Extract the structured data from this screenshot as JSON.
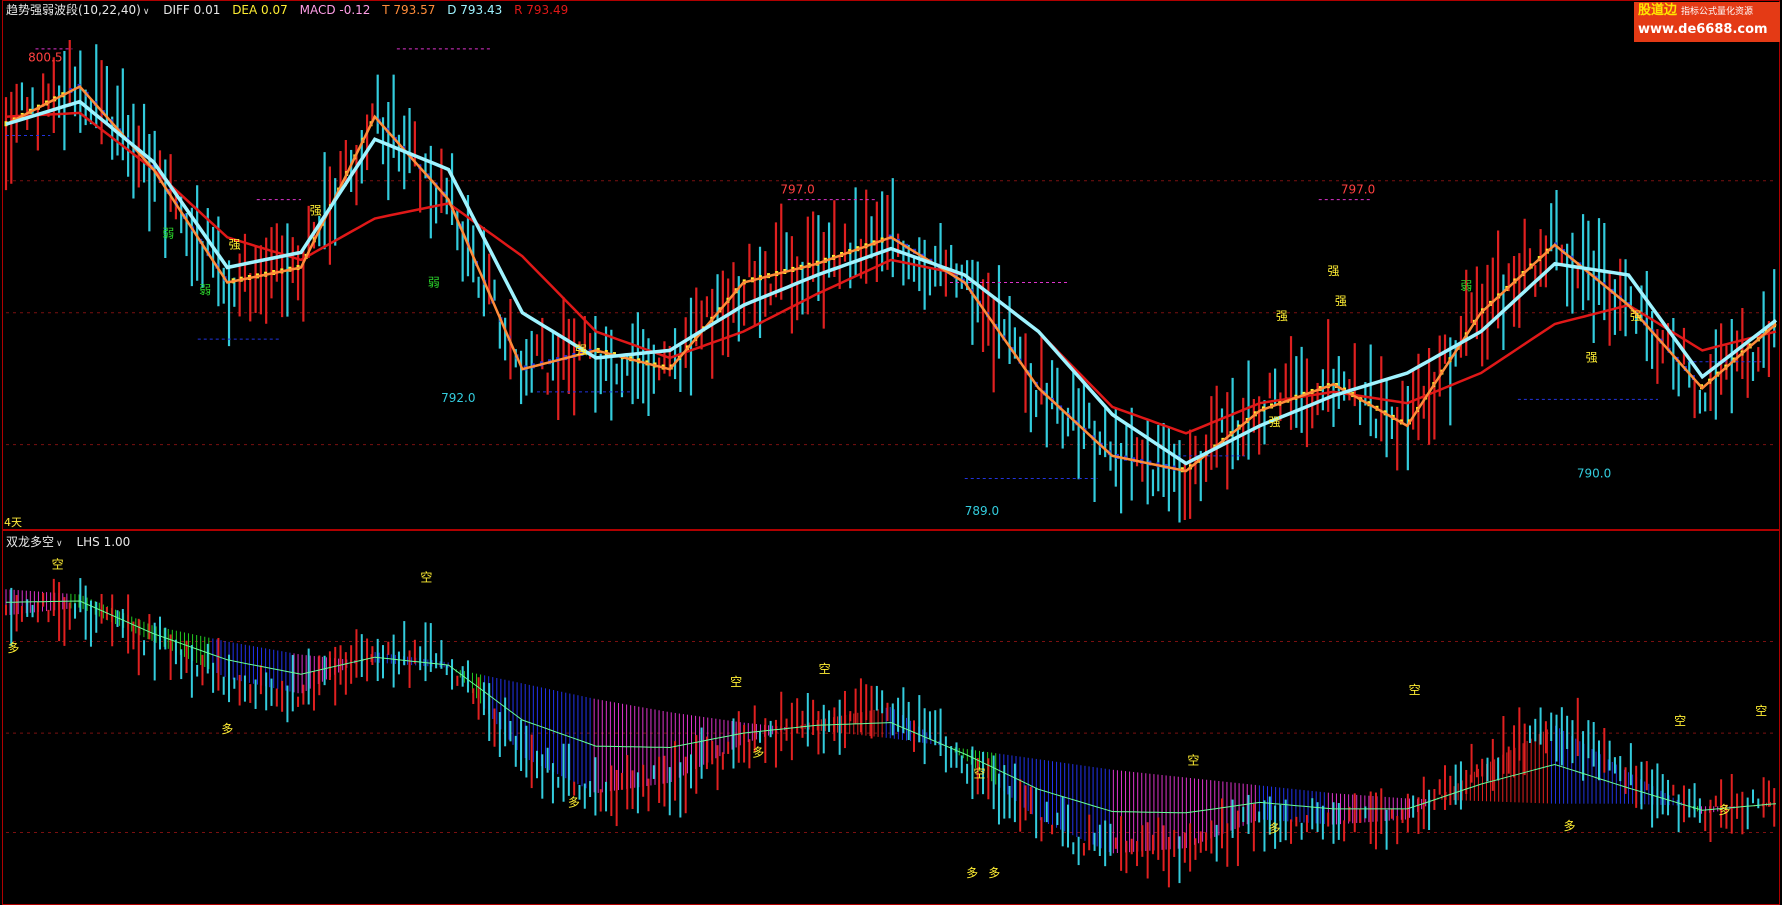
{
  "header_top": {
    "indicator_name": "趋势强弱波段(10,22,40)",
    "diff_label": "DIFF 0.01",
    "dea_label": "DEA 0.07",
    "macd_label": "MACD -0.12",
    "t_label": "T 793.57",
    "d_label": "D 793.43",
    "r_label": "R 793.49"
  },
  "header_bottom": {
    "indicator_name": "双龙多空",
    "lhs_label": "LHS 1.00"
  },
  "days_label": "4天",
  "logo": {
    "line1": "股道边",
    "line1_small": "指标公式量化资源",
    "line2": "www.de6688.com"
  },
  "colors": {
    "background": "#000000",
    "border": "#b00000",
    "up_bar": "#e02020",
    "down_bar": "#33ccdd",
    "white_line": "#9ff3ff",
    "orange_line": "#ff8c3a",
    "red_line": "#e01818",
    "label_yellow": "#ffee33",
    "label_red": "#ff4040",
    "label_cyan": "#33ccdd",
    "dashed_red": "#7a1010",
    "magenta_dash": "#dd33cc",
    "blue_dash": "#2233dd"
  },
  "chart_data": [
    {
      "type": "line",
      "panel": "top",
      "x": [
        0,
        10,
        20,
        30,
        40,
        50,
        60,
        70,
        80,
        90,
        100,
        110,
        120,
        130,
        140,
        150,
        160,
        170,
        180,
        190,
        200,
        210,
        220,
        230,
        240
      ],
      "ylim": [
        788.5,
        801.5
      ],
      "series": [
        {
          "key": "white",
          "values": [
            799.0,
            799.6,
            798.0,
            795.2,
            795.6,
            798.6,
            797.8,
            794.0,
            792.8,
            793.0,
            794.2,
            795.0,
            795.7,
            795.0,
            793.5,
            791.3,
            790.0,
            791.0,
            791.8,
            792.4,
            793.5,
            795.3,
            795.0,
            792.3,
            793.8
          ]
        },
        {
          "key": "orange",
          "values": [
            799.0,
            800.0,
            797.8,
            794.8,
            795.2,
            799.2,
            797.0,
            792.5,
            793.0,
            792.5,
            794.8,
            795.3,
            796.0,
            794.8,
            792.0,
            790.2,
            789.8,
            791.4,
            792.1,
            791.0,
            794.0,
            795.8,
            794.2,
            792.0,
            793.7
          ]
        },
        {
          "key": "red",
          "values": [
            799.2,
            799.3,
            797.8,
            796.0,
            795.4,
            796.5,
            796.9,
            795.5,
            793.5,
            792.8,
            793.5,
            794.5,
            795.4,
            795.0,
            793.5,
            791.5,
            790.8,
            791.6,
            791.9,
            791.6,
            792.4,
            793.7,
            794.2,
            793.0,
            793.5
          ]
        }
      ],
      "annotations": [
        {
          "text": "800.5",
          "x": 3,
          "y": 800.5,
          "color": "label_red"
        },
        {
          "text": "797.0",
          "x": 105,
          "y": 797.0,
          "color": "label_red"
        },
        {
          "text": "797.0",
          "x": 181,
          "y": 797.0,
          "color": "label_red"
        },
        {
          "text": "792.0",
          "x": 59,
          "y": 792.0,
          "color": "label_cyan"
        },
        {
          "text": "789.0",
          "x": 130,
          "y": 789.0,
          "color": "label_cyan"
        },
        {
          "text": "790.0",
          "x": 213,
          "y": 790.0,
          "color": "label_cyan"
        }
      ],
      "strength_labels": [
        {
          "text": "弱",
          "x": 22,
          "y": 796.0,
          "color": "#2bd62b"
        },
        {
          "text": "弱",
          "x": 27,
          "y": 794.5,
          "color": "#2bd62b"
        },
        {
          "text": "弱",
          "x": 58,
          "y": 794.7,
          "color": "#2bd62b"
        },
        {
          "text": "强",
          "x": 31,
          "y": 795.7,
          "color": "label_yellow"
        },
        {
          "text": "强",
          "x": 42,
          "y": 796.6,
          "color": "label_yellow"
        },
        {
          "text": "强",
          "x": 78,
          "y": 792.9,
          "color": "label_yellow"
        },
        {
          "text": "强",
          "x": 173,
          "y": 793.8,
          "color": "label_yellow"
        },
        {
          "text": "强",
          "x": 180,
          "y": 795.0,
          "color": "label_yellow"
        },
        {
          "text": "强",
          "x": 181,
          "y": 794.2,
          "color": "label_yellow"
        },
        {
          "text": "强",
          "x": 172,
          "y": 791.0,
          "color": "label_yellow"
        },
        {
          "text": "强",
          "x": 215,
          "y": 792.7,
          "color": "label_yellow"
        },
        {
          "text": "强",
          "x": 221,
          "y": 793.8,
          "color": "label_yellow"
        },
        {
          "text": "弱",
          "x": 198,
          "y": 794.6,
          "color": "#2bd62b"
        }
      ]
    },
    {
      "type": "area",
      "panel": "bottom",
      "x": [
        0,
        10,
        20,
        30,
        40,
        50,
        60,
        70,
        80,
        90,
        100,
        110,
        120,
        130,
        140,
        150,
        160,
        170,
        180,
        190,
        200,
        210,
        220,
        230,
        240
      ],
      "ylim": [
        788.5,
        801.5
      ],
      "series": [
        {
          "key": "upper_band",
          "values": [
            800.0,
            799.8,
            798.6,
            798.0,
            797.5,
            797.2,
            797.0,
            796.4,
            795.8,
            795.3,
            794.9,
            794.6,
            794.3,
            793.9,
            793.5,
            793.1,
            792.8,
            792.5,
            792.2,
            792.0,
            791.9,
            791.8,
            791.8,
            791.7,
            791.7
          ]
        },
        {
          "key": "lower_band",
          "values": [
            799.0,
            799.3,
            798.0,
            796.6,
            796.0,
            797.6,
            797.2,
            793.6,
            792.2,
            792.6,
            794.1,
            795.0,
            795.5,
            793.5,
            791.2,
            789.9,
            790.1,
            791.2,
            791.0,
            791.2,
            793.2,
            794.8,
            793.0,
            791.4,
            791.9
          ]
        }
      ],
      "signal_labels": [
        {
          "text": "空",
          "x": 7,
          "y": 800.8
        },
        {
          "text": "空",
          "x": 57,
          "y": 800.3
        },
        {
          "text": "空",
          "x": 99,
          "y": 796.3
        },
        {
          "text": "空",
          "x": 111,
          "y": 796.8
        },
        {
          "text": "空",
          "x": 132,
          "y": 792.8
        },
        {
          "text": "空",
          "x": 161,
          "y": 793.3
        },
        {
          "text": "空",
          "x": 191,
          "y": 796.0
        },
        {
          "text": "空",
          "x": 227,
          "y": 794.8
        },
        {
          "text": "空",
          "x": 238,
          "y": 795.2
        },
        {
          "text": "多",
          "x": 1,
          "y": 797.6
        },
        {
          "text": "多",
          "x": 30,
          "y": 794.5
        },
        {
          "text": "多",
          "x": 77,
          "y": 791.7
        },
        {
          "text": "多",
          "x": 102,
          "y": 793.6
        },
        {
          "text": "多",
          "x": 131,
          "y": 789.0
        },
        {
          "text": "多",
          "x": 134,
          "y": 789.0
        },
        {
          "text": "多",
          "x": 172,
          "y": 790.7
        },
        {
          "text": "多",
          "x": 212,
          "y": 790.8
        },
        {
          "text": "多",
          "x": 233,
          "y": 791.4
        }
      ]
    }
  ]
}
